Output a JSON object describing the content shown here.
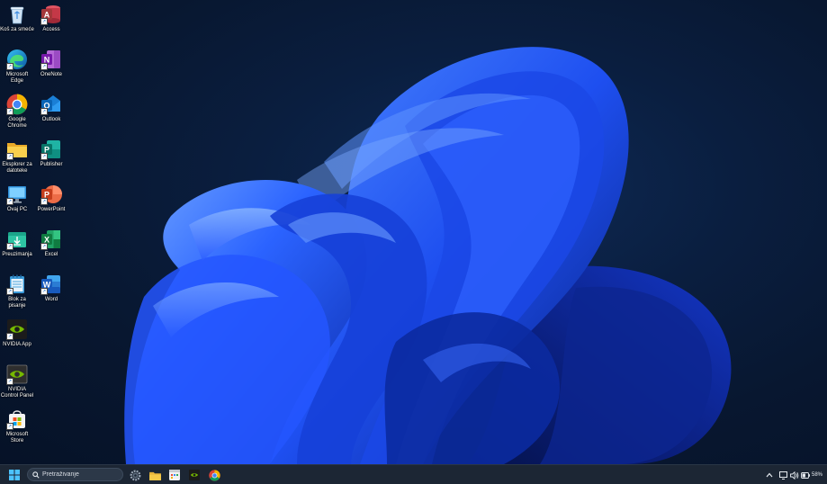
{
  "desktop": {
    "icons_left": [
      {
        "label": "Koš za smeće",
        "icon": "recycle-bin-icon"
      },
      {
        "label": "Microsoft Edge",
        "icon": "edge-icon"
      },
      {
        "label": "Google Chrome",
        "icon": "chrome-icon"
      },
      {
        "label": "Eksplorer za datoteke",
        "icon": "file-explorer-icon"
      },
      {
        "label": "Ovaj PC",
        "icon": "this-pc-icon"
      },
      {
        "label": "Preuzimanja",
        "icon": "downloads-folder-icon"
      },
      {
        "label": "Blok za pisanje",
        "icon": "notepad-icon"
      },
      {
        "label": "NVIDIA App",
        "icon": "nvidia-app-icon"
      },
      {
        "label": "NVIDIA Control Panel",
        "icon": "nvidia-control-panel-icon"
      },
      {
        "label": "Microsoft Store",
        "icon": "microsoft-store-icon"
      }
    ],
    "icons_right": [
      {
        "label": "Access",
        "icon": "access-icon"
      },
      {
        "label": "OneNote",
        "icon": "onenote-icon"
      },
      {
        "label": "Outlook",
        "icon": "outlook-icon"
      },
      {
        "label": "Publisher",
        "icon": "publisher-icon"
      },
      {
        "label": "PowerPoint",
        "icon": "powerpoint-icon"
      },
      {
        "label": "Excel",
        "icon": "excel-icon"
      },
      {
        "label": "Word",
        "icon": "word-icon"
      }
    ]
  },
  "taskbar": {
    "search": {
      "placeholder": "Pretraživanje"
    },
    "pinned": [
      "start-icon",
      "settings-icon",
      "file-explorer-icon",
      "calendar-app-icon",
      "nvidia-icon",
      "chrome-icon"
    ],
    "tray": {
      "battery_percent": "58%"
    }
  },
  "colors": {
    "wallpaper_bg": "#0a1e3f",
    "bloom_blue": "#1e52ff",
    "taskbar_bg": "#1c2634"
  }
}
